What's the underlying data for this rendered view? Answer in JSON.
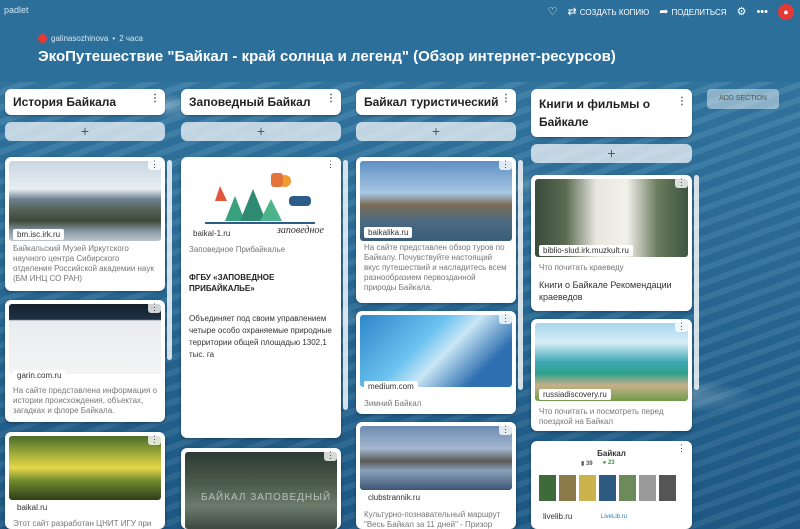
{
  "app": {
    "brand": "padlet"
  },
  "toolbar": {
    "copy": "СОЗДАТЬ КОПИЮ",
    "share": "ПОДЕЛИТЬСЯ"
  },
  "author": {
    "name": "galinasozhinova",
    "time": "2 часа"
  },
  "title": "ЭкоПутешествие \"Байкал - край солнца и легенд\" (Обзор интернет-ресурсов)",
  "add_section": "ADD SECTION",
  "columns": [
    {
      "title": "История Байкала",
      "cards": [
        {
          "url": "bm.isc.irk.ru",
          "desc": "Байкальский Музей Иркутского научного центра Сибирского отделения Российской академии наук (БМ ИНЦ СО РАН)"
        },
        {
          "url": "garin.com.ru",
          "desc": "На сайте представлена информация о истории происхождения, объектах, загадках и флоре Байкала."
        },
        {
          "url": "baikal.ru",
          "desc": "Этот сайт разработан ЦНИТ ИГУ при"
        }
      ]
    },
    {
      "title": "Заповедный Байкал",
      "cards": [
        {
          "url": "baikal-1.ru",
          "source": "Заповедное Прибайкалье",
          "heading": "ФГБУ «ЗАПОВЕДНОЕ ПРИБАЙКАЛЬЕ»",
          "body": "Объединяет под своим управлением четыре особо охраняемые природные территории общей площадью 1302,1 тыс. га",
          "logo": "заповедное"
        },
        {
          "overlay": "БАЙКАЛ ЗАПОВЕДНЫЙ"
        }
      ]
    },
    {
      "title": "Байкал туристический",
      "cards": [
        {
          "url": "baikalika.ru",
          "desc": "На сайте представлен обзор туров по Байкалу. Почувствуйте настоящий вкус путешествий и насладитесь всем разнообразием первозданной природы Байкала."
        },
        {
          "url": "medium.com",
          "desc": "Зимний Байкал"
        },
        {
          "url": "clubstrannik.ru",
          "desc": "Культурно-познавательный маршрут \"Весь Байкал за 11 дней\" - Призор"
        }
      ]
    },
    {
      "title": "Книги и фильмы о Байкале",
      "cards": [
        {
          "url": "biblio-slud.irk.muzkult.ru",
          "source": "Что почитать краеведу",
          "heading": "Книги о Байкале Рекомендации краеведов"
        },
        {
          "url": "russiadiscovery.ru",
          "desc": "Что почитать и посмотреть перед поездкой на Байкал"
        },
        {
          "url": "livelib.ru",
          "heading": "Байкал",
          "stat1": "39",
          "stat2": "23",
          "brand": "LiveLib.ru"
        }
      ]
    }
  ]
}
